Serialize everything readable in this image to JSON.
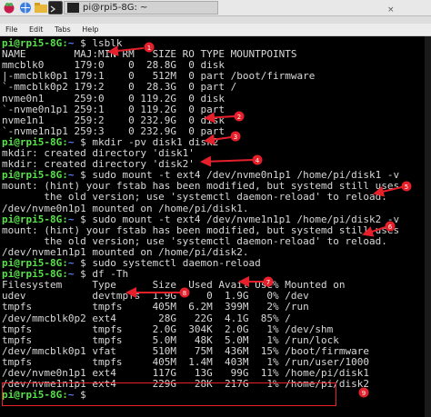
{
  "window": {
    "title": "pi@rpi5-8G: ~",
    "menu": [
      "File",
      "Edit",
      "Tabs",
      "Help"
    ]
  },
  "terminal": {
    "lines": [
      {
        "p": "pi@rpi5-8G",
        "d": "~",
        "c": " $ lsblk"
      },
      {
        "t": "NAME        MAJ:MIN RM   SIZE RO TYPE MOUNTPOINTS"
      },
      {
        "t": "mmcblk0     179:0    0  28.8G  0 disk"
      },
      {
        "t": "|-mmcblk0p1 179:1    0   512M  0 part /boot/firmware"
      },
      {
        "t": "`-mmcblk0p2 179:2    0  28.3G  0 part /"
      },
      {
        "t": "nvme0n1     259:0    0 119.2G  0 disk"
      },
      {
        "t": "`-nvme0n1p1 259:1    0 119.2G  0 part"
      },
      {
        "t": "nvme1n1     259:2    0 232.9G  0 disk"
      },
      {
        "t": "`-nvme1n1p1 259:3    0 232.9G  0 part"
      },
      {
        "p": "pi@rpi5-8G",
        "d": "~",
        "c": " $ mkdir -pv disk1 disk2"
      },
      {
        "t": "mkdir: created directory 'disk1'"
      },
      {
        "t": "mkdir: created directory 'disk2'"
      },
      {
        "p": "pi@rpi5-8G",
        "d": "~",
        "c": " $ sudo mount -t ext4 /dev/nvme0n1p1 /home/pi/disk1 -v"
      },
      {
        "t": "mount: (hint) your fstab has been modified, but systemd still uses"
      },
      {
        "t": "       the old version; use 'systemctl daemon-reload' to reload."
      },
      {
        "t": "/dev/nvme0n1p1 mounted on /home/pi/disk1."
      },
      {
        "p": "pi@rpi5-8G",
        "d": "~",
        "c": " $ sudo mount -t ext4 /dev/nvme1n1p1 /home/pi/disk2 -v"
      },
      {
        "t": "mount: (hint) your fstab has been modified, but systemd still uses"
      },
      {
        "t": "       the old version; use 'systemctl daemon-reload' to reload."
      },
      {
        "t": "/dev/nvme1n1p1 mounted on /home/pi/disk2."
      },
      {
        "p": "pi@rpi5-8G",
        "d": "~",
        "c": " $ sudo systemctl daemon-reload"
      },
      {
        "p": "pi@rpi5-8G",
        "d": "~",
        "c": " $ df -Th"
      },
      {
        "t": "Filesystem     Type      Size  Used Avail Use% Mounted on"
      },
      {
        "t": "udev           devtmpfs  1.9G     0  1.9G   0% /dev"
      },
      {
        "t": "tmpfs          tmpfs     405M  6.2M  399M   2% /run"
      },
      {
        "t": "/dev/mmcblk0p2 ext4       28G   22G  4.1G  85% /"
      },
      {
        "t": "tmpfs          tmpfs     2.0G  304K  2.0G   1% /dev/shm"
      },
      {
        "t": "tmpfs          tmpfs     5.0M   48K  5.0M   1% /run/lock"
      },
      {
        "t": "/dev/mmcblk0p1 vfat      510M   75M  436M  15% /boot/firmware"
      },
      {
        "t": "tmpfs          tmpfs     405M  1.4M  403M   1% /run/user/1000"
      },
      {
        "t": "/dev/nvme0n1p1 ext4      117G   13G   99G  11% /home/pi/disk1"
      },
      {
        "t": "/dev/nvme1n1p1 ext4      229G   28K  217G   1% /home/pi/disk2"
      },
      {
        "p": "pi@rpi5-8G",
        "d": "~",
        "c": " $ "
      }
    ]
  },
  "annotations": [
    "1",
    "2",
    "3",
    "4",
    "5",
    "6",
    "7",
    "8",
    "9"
  ],
  "colors": {
    "annotation": "#e5202a",
    "prompt": "#58e34a",
    "path": "#5a7dff"
  }
}
